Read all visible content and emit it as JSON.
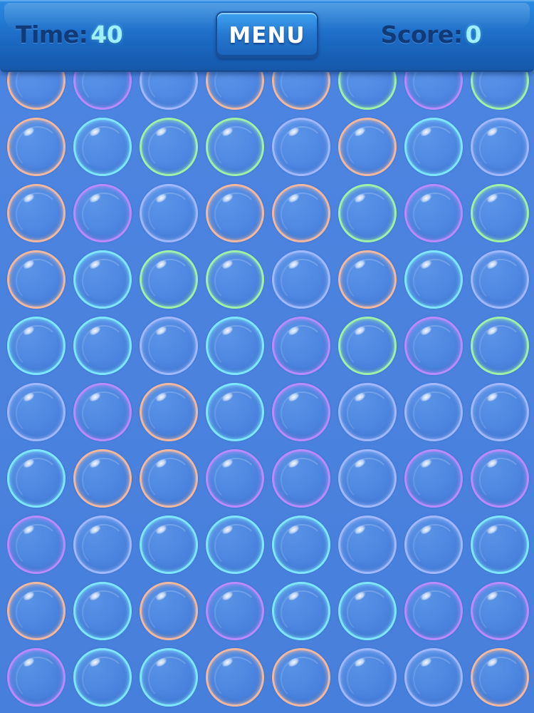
{
  "hud": {
    "time_label": "Time:",
    "time_value": "40",
    "menu_label": "MENU",
    "score_label": "Score:",
    "score_value": "0"
  },
  "colors": {
    "background": "#4a84e0",
    "topbar": "#1c6ac4",
    "hud_label": "#103a78",
    "hud_value": "#9ff0ff",
    "menu_text": "#ffffff"
  },
  "board": {
    "columns": 8,
    "rows": 10,
    "state": "all bubbles unpopped",
    "rim_palette": {
      "cyan": "#7fe6ff",
      "violet": "#b88bff",
      "green": "#9ff0a8",
      "peach": "#f0b8a0",
      "blue": "#9fb8ff"
    },
    "rims": [
      [
        "peach",
        "violet",
        "blue",
        "peach",
        "peach",
        "green",
        "violet",
        "green"
      ],
      [
        "peach",
        "cyan",
        "green",
        "green",
        "blue",
        "peach",
        "cyan",
        "blue"
      ],
      [
        "peach",
        "violet",
        "blue",
        "peach",
        "peach",
        "green",
        "violet",
        "green"
      ],
      [
        "peach",
        "cyan",
        "green",
        "green",
        "blue",
        "peach",
        "cyan",
        "blue"
      ],
      [
        "cyan",
        "cyan",
        "blue",
        "cyan",
        "violet",
        "green",
        "violet",
        "green"
      ],
      [
        "blue",
        "violet",
        "peach",
        "cyan",
        "violet",
        "blue",
        "blue",
        "blue"
      ],
      [
        "cyan",
        "peach",
        "peach",
        "violet",
        "violet",
        "blue",
        "violet",
        "violet"
      ],
      [
        "violet",
        "blue",
        "cyan",
        "cyan",
        "cyan",
        "blue",
        "blue",
        "cyan"
      ],
      [
        "peach",
        "cyan",
        "peach",
        "violet",
        "cyan",
        "cyan",
        "violet",
        "violet"
      ],
      [
        "violet",
        "cyan",
        "cyan",
        "peach",
        "peach",
        "blue",
        "blue",
        "peach"
      ]
    ]
  }
}
